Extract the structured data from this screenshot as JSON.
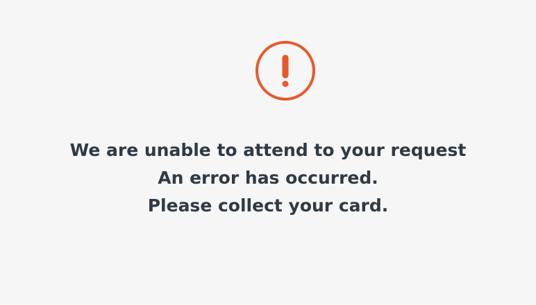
{
  "screen": {
    "background_color": "#f6f6f6",
    "accent_color": "#e8582a",
    "text_color": "#2f3a45",
    "icon": "exclamation-circle-icon",
    "messages": [
      "We are unable to attend to your request",
      "An error has occurred.",
      "Please collect your card."
    ]
  }
}
